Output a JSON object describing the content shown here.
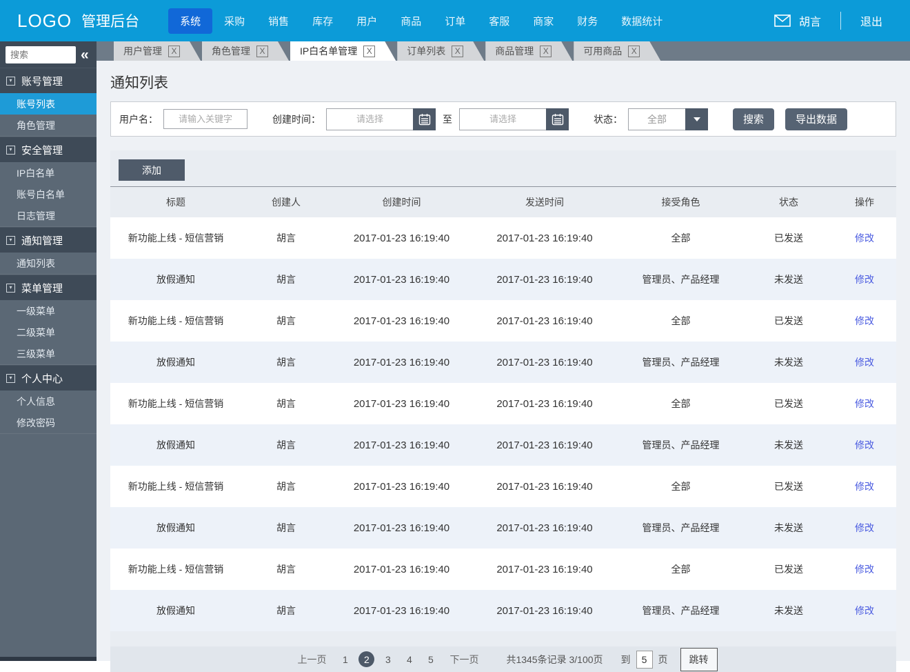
{
  "topbar": {
    "logo": "LOGO",
    "title": "管理后台",
    "nav": [
      {
        "label": "系统",
        "active": true
      },
      {
        "label": "采购"
      },
      {
        "label": "销售"
      },
      {
        "label": "库存"
      },
      {
        "label": "用户"
      },
      {
        "label": "商品"
      },
      {
        "label": "订单"
      },
      {
        "label": "客服"
      },
      {
        "label": "商家"
      },
      {
        "label": "财务"
      },
      {
        "label": "数据统计"
      }
    ],
    "user": "胡言",
    "logout": "退出"
  },
  "sidebar": {
    "search_placeholder": "搜索",
    "collapse_glyph": "«",
    "sections": [
      {
        "title": "账号管理",
        "items": [
          {
            "label": "账号列表",
            "active": true
          },
          {
            "label": "角色管理"
          }
        ]
      },
      {
        "title": "安全管理",
        "items": [
          {
            "label": "IP白名单"
          },
          {
            "label": "账号白名单"
          },
          {
            "label": "日志管理"
          }
        ]
      },
      {
        "title": "通知管理",
        "items": [
          {
            "label": "通知列表"
          }
        ]
      },
      {
        "title": "菜单管理",
        "items": [
          {
            "label": "一级菜单"
          },
          {
            "label": "二级菜单"
          },
          {
            "label": "三级菜单"
          }
        ]
      },
      {
        "title": "个人中心",
        "items": [
          {
            "label": "个人信息"
          },
          {
            "label": "修改密码"
          }
        ]
      }
    ]
  },
  "ui": {
    "close_label": "X"
  },
  "tabs": [
    {
      "label": "用户管理"
    },
    {
      "label": "角色管理"
    },
    {
      "label": "IP白名单管理",
      "active": true
    },
    {
      "label": "订单列表"
    },
    {
      "label": "商品管理"
    },
    {
      "label": "可用商品"
    }
  ],
  "page": {
    "title": "通知列表",
    "filters": {
      "username_label": "用户名：",
      "username_placeholder": "请输入关键字",
      "created_label": "创建时间：",
      "date_placeholder": "请选择",
      "to_label": "至",
      "status_label": "状态：",
      "status_value": "全部",
      "search_button": "搜索",
      "export_button": "导出数据"
    },
    "add_button": "添加",
    "table": {
      "columns": [
        "标题",
        "创建人",
        "创建时间",
        "发送时间",
        "接受角色",
        "状态",
        "操作"
      ],
      "rows": [
        {
          "title": "新功能上线 - 短信营销",
          "creator": "胡言",
          "created": "2017-01-23 16:19:40",
          "sent": "2017-01-23 16:19:40",
          "roles": "全部",
          "status": "已发送",
          "action": "修改"
        },
        {
          "title": "放假通知",
          "creator": "胡言",
          "created": "2017-01-23 16:19:40",
          "sent": "2017-01-23 16:19:40",
          "roles": "管理员、产品经理",
          "status": "未发送",
          "action": "修改"
        },
        {
          "title": "新功能上线 - 短信营销",
          "creator": "胡言",
          "created": "2017-01-23 16:19:40",
          "sent": "2017-01-23 16:19:40",
          "roles": "全部",
          "status": "已发送",
          "action": "修改"
        },
        {
          "title": "放假通知",
          "creator": "胡言",
          "created": "2017-01-23 16:19:40",
          "sent": "2017-01-23 16:19:40",
          "roles": "管理员、产品经理",
          "status": "未发送",
          "action": "修改"
        },
        {
          "title": "新功能上线 - 短信营销",
          "creator": "胡言",
          "created": "2017-01-23 16:19:40",
          "sent": "2017-01-23 16:19:40",
          "roles": "全部",
          "status": "已发送",
          "action": "修改"
        },
        {
          "title": "放假通知",
          "creator": "胡言",
          "created": "2017-01-23 16:19:40",
          "sent": "2017-01-23 16:19:40",
          "roles": "管理员、产品经理",
          "status": "未发送",
          "action": "修改"
        },
        {
          "title": "新功能上线 - 短信营销",
          "creator": "胡言",
          "created": "2017-01-23 16:19:40",
          "sent": "2017-01-23 16:19:40",
          "roles": "全部",
          "status": "已发送",
          "action": "修改"
        },
        {
          "title": "放假通知",
          "creator": "胡言",
          "created": "2017-01-23 16:19:40",
          "sent": "2017-01-23 16:19:40",
          "roles": "管理员、产品经理",
          "status": "未发送",
          "action": "修改"
        },
        {
          "title": "新功能上线 - 短信营销",
          "creator": "胡言",
          "created": "2017-01-23 16:19:40",
          "sent": "2017-01-23 16:19:40",
          "roles": "全部",
          "status": "已发送",
          "action": "修改"
        },
        {
          "title": "放假通知",
          "creator": "胡言",
          "created": "2017-01-23 16:19:40",
          "sent": "2017-01-23 16:19:40",
          "roles": "管理员、产品经理",
          "status": "未发送",
          "action": "修改"
        }
      ]
    },
    "pagination": {
      "prev": "上一页",
      "pages": [
        {
          "label": "1"
        },
        {
          "label": "2",
          "active": true
        },
        {
          "label": "3"
        },
        {
          "label": "4"
        },
        {
          "label": "5"
        }
      ],
      "next": "下一页",
      "summary": "共1345条记录 3/100页",
      "goto_label": "到",
      "goto_value": "5",
      "page_unit": "页",
      "jump_button": "跳转"
    }
  },
  "colors": {
    "topbar": "#0c9bd8",
    "nav_active": "#1168d8",
    "sidebar_header": "#3e4a57",
    "sidebar_body": "#5b6875",
    "sidebar_active": "#1e9bd7",
    "tabbar": "#6e7b88",
    "dark_button": "#566373",
    "row_stripe": "#edf2f9",
    "link": "#4a5be0"
  }
}
